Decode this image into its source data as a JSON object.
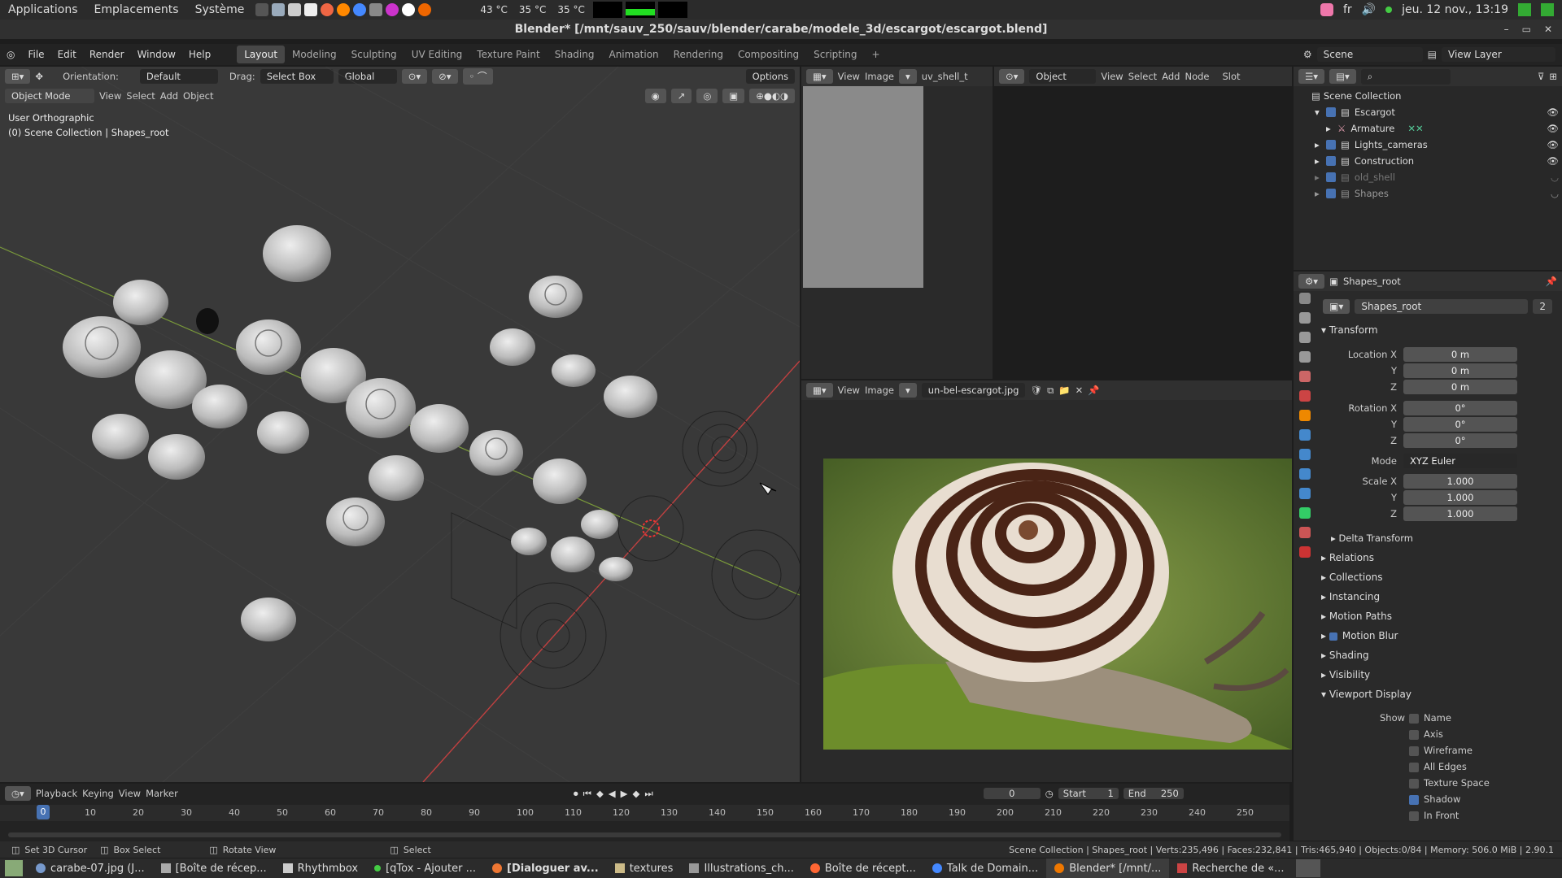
{
  "sysbar": {
    "applications": "Applications",
    "places": "Emplacements",
    "system": "Système",
    "temp1": "43 °C",
    "temp2": "35 °C",
    "temp3": "35 °C",
    "lang": "fr",
    "datetime": "jeu. 12 nov., 13:19"
  },
  "window": {
    "title": "Blender* [/mnt/sauv_250/sauv/blender/carabe/modele_3d/escargot/escargot.blend]"
  },
  "menu": {
    "items": [
      "File",
      "Edit",
      "Render",
      "Window",
      "Help"
    ]
  },
  "workspaces": [
    "Layout",
    "Modeling",
    "Sculpting",
    "UV Editing",
    "Texture Paint",
    "Shading",
    "Animation",
    "Rendering",
    "Compositing",
    "Scripting"
  ],
  "workspace_active": "Layout",
  "scene": {
    "scene_label": "Scene",
    "view_layer_label": "View Layer"
  },
  "viewport": {
    "orientation_label": "Orientation:",
    "orientation_value": "Default",
    "drag_label": "Drag:",
    "drag_value": "Select Box",
    "transform_value": "Global",
    "options_label": "Options",
    "mode": "Object Mode",
    "menu": [
      "View",
      "Select",
      "Add",
      "Object"
    ],
    "info_view": "User Orthographic",
    "info_collection": "(0) Scene Collection | Shapes_root"
  },
  "image_editor_top": {
    "menu": [
      "View",
      "Image"
    ],
    "image_name": "uv_shell_t"
  },
  "node_editor": {
    "object_label": "Object",
    "menu": [
      "View",
      "Select",
      "Add",
      "Node"
    ],
    "slot_label": "Slot"
  },
  "image_editor_bottom": {
    "menu": [
      "View",
      "Image"
    ],
    "image_name": "un-bel-escargot.jpg"
  },
  "outliner": {
    "root": "Scene Collection",
    "items": [
      {
        "name": "Escargot",
        "indent": 1
      },
      {
        "name": "Armature",
        "indent": 2
      },
      {
        "name": "Lights_cameras",
        "indent": 1
      },
      {
        "name": "Construction",
        "indent": 1
      },
      {
        "name": "old_shell",
        "indent": 1
      },
      {
        "name": "Shapes",
        "indent": 1
      }
    ]
  },
  "properties": {
    "object_name": "Shapes_root",
    "data_name": "Shapes_root",
    "users": "2",
    "transform_title": "Transform",
    "location_x": "0 m",
    "location_y": "0 m",
    "location_z": "0 m",
    "rotation_x": "0°",
    "rotation_y": "0°",
    "rotation_z": "0°",
    "rotation_mode_label": "Mode",
    "rotation_mode": "XYZ Euler",
    "scale_x": "1.000",
    "scale_y": "1.000",
    "scale_z": "1.000",
    "labels": {
      "location_x": "Location X",
      "y": "Y",
      "z": "Z",
      "rotation_x": "Rotation X",
      "scale_x": "Scale X"
    },
    "delta": "Delta Transform",
    "sections": [
      "Relations",
      "Collections",
      "Instancing",
      "Motion Paths",
      "Motion Blur",
      "Shading",
      "Visibility",
      "Viewport Display"
    ],
    "show_label": "Show",
    "show_items": [
      {
        "label": "Name",
        "on": false
      },
      {
        "label": "Axis",
        "on": false
      },
      {
        "label": "Wireframe",
        "on": false
      },
      {
        "label": "All Edges",
        "on": false
      },
      {
        "label": "Texture Space",
        "on": false
      },
      {
        "label": "Shadow",
        "on": true
      },
      {
        "label": "In Front",
        "on": false
      }
    ]
  },
  "timeline": {
    "menu": [
      "Playback",
      "Keying",
      "View",
      "Marker"
    ],
    "current_frame": "0",
    "start_label": "Start",
    "start": "1",
    "end_label": "End",
    "end": "250",
    "ticks": [
      "0",
      "10",
      "20",
      "30",
      "40",
      "50",
      "60",
      "70",
      "80",
      "90",
      "100",
      "110",
      "120",
      "130",
      "140",
      "150",
      "160",
      "170",
      "180",
      "190",
      "200",
      "210",
      "220",
      "230",
      "240",
      "250"
    ]
  },
  "status": {
    "left1": "Set 3D Cursor",
    "left2": "Box Select",
    "left3": "Rotate View",
    "left4": "Select",
    "stats": "Scene Collection | Shapes_root | Verts:235,496 | Faces:232,841 | Tris:465,940 | Objects:0/84 | Memory: 506.0 MiB | 2.90.1"
  },
  "taskbar": [
    {
      "label": "carabe-07.jpg (J...",
      "bold": false,
      "active": false
    },
    {
      "label": "[Boîte de récep...",
      "bold": false,
      "active": false
    },
    {
      "label": "Rhythmbox",
      "bold": false,
      "active": false
    },
    {
      "label": "[qTox - Ajouter ...",
      "bold": false,
      "active": false
    },
    {
      "label": "[Dialoguer av...",
      "bold": true,
      "active": false
    },
    {
      "label": "textures",
      "bold": false,
      "active": false
    },
    {
      "label": "Illustrations_ch...",
      "bold": false,
      "active": false
    },
    {
      "label": "Boîte de récept...",
      "bold": false,
      "active": false
    },
    {
      "label": "Talk de Domain...",
      "bold": false,
      "active": false
    },
    {
      "label": "Blender* [/mnt/...",
      "bold": false,
      "active": true
    },
    {
      "label": "Recherche de «...",
      "bold": false,
      "active": false
    }
  ]
}
